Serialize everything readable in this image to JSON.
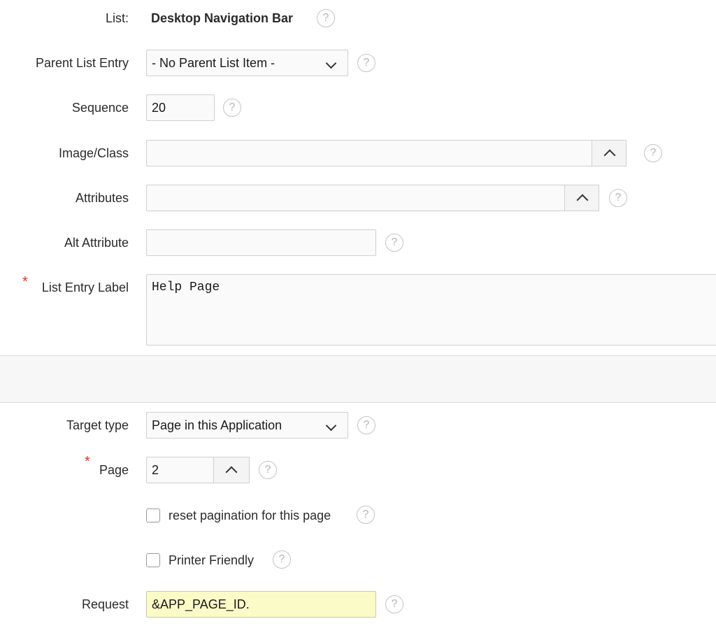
{
  "list": {
    "label": "List:",
    "value": "Desktop Navigation Bar"
  },
  "parent_list_entry": {
    "label": "Parent List Entry",
    "value": "- No Parent List Item -"
  },
  "sequence": {
    "label": "Sequence",
    "value": "20"
  },
  "image_class": {
    "label": "Image/Class",
    "value": ""
  },
  "attributes": {
    "label": "Attributes",
    "value": ""
  },
  "alt_attribute": {
    "label": "Alt Attribute",
    "value": ""
  },
  "list_entry_label": {
    "label": "List Entry Label",
    "required_mark": "*",
    "value": "Help Page"
  },
  "target_type": {
    "label": "Target type",
    "value": "Page in this Application"
  },
  "page": {
    "label": "Page",
    "required_mark": "*",
    "value": "2"
  },
  "reset_pagination": {
    "label": "reset pagination for this page",
    "checked": false
  },
  "printer_friendly": {
    "label": "Printer Friendly",
    "checked": false
  },
  "request": {
    "label": "Request",
    "value": "&APP_PAGE_ID."
  },
  "help_glyph": "?",
  "icons": {
    "help": "help-circle-icon",
    "dropdown": "chevron-down-icon",
    "popup": "chevron-up-icon"
  },
  "colors": {
    "required": "#e0352b",
    "request_highlight": "#fbfbc8"
  }
}
